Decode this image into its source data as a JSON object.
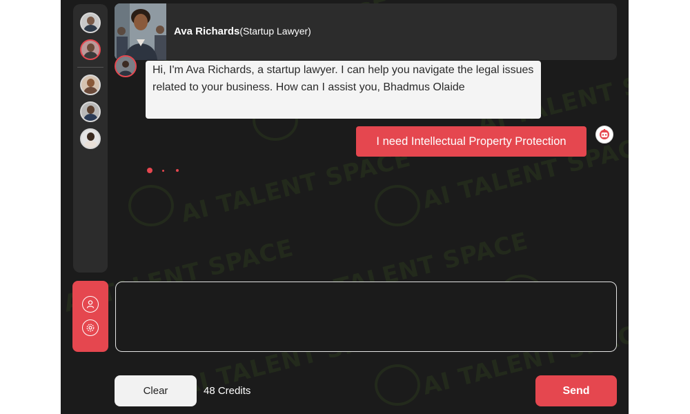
{
  "header": {
    "name": "Ava Richards",
    "role": "(Startup Lawyer)"
  },
  "watermark": {
    "text": "AI TALENT SPACE"
  },
  "sidebar": {
    "avatars": [
      {
        "name": "avatar-1",
        "active": false
      },
      {
        "name": "avatar-2",
        "active": true
      },
      {
        "name": "avatar-3",
        "active": false
      },
      {
        "name": "avatar-4",
        "active": false
      },
      {
        "name": "avatar-5",
        "active": false
      }
    ]
  },
  "actions": {
    "profile_icon": "user-icon",
    "settings_icon": "gear-icon"
  },
  "messages": [
    {
      "from": "bot",
      "text": "Hi, I'm Ava Richards, a startup lawyer. I can help you navigate the legal issues related to your business. How can I assist you, Bhadmus Olaide"
    },
    {
      "from": "user",
      "text": "I need Intellectual Property Protection"
    }
  ],
  "composer": {
    "value": "",
    "placeholder": ""
  },
  "footer": {
    "clear_label": "Clear",
    "credits": "48 Credits",
    "send_label": "Send"
  },
  "colors": {
    "accent": "#e5474f",
    "background": "#1b1b1b",
    "panel": "#2c2c2c"
  }
}
